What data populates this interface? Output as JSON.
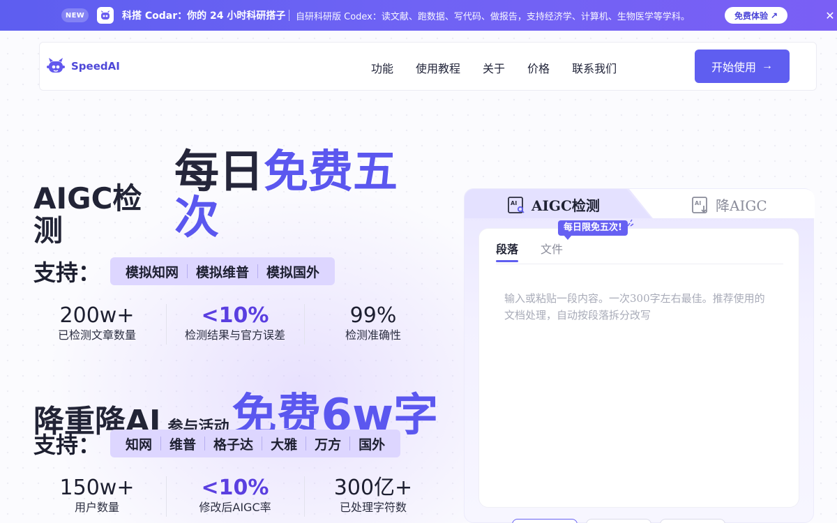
{
  "announcement": {
    "badge": "NEW",
    "title": "科搭 Codar：你的 24 小时科研搭子",
    "description": "自研科研版 Codex：读文献、跑数据、写代码、做报告，支持经济学、计算机、生物医学等学科。",
    "cta_label": "免费体验",
    "close_icon": "close-icon"
  },
  "nav": {
    "brand": "SpeedAI",
    "links": [
      "功能",
      "使用教程",
      "关于",
      "价格",
      "联系我们"
    ],
    "start_label": "开始使用"
  },
  "hero": {
    "aigc_title": "AIGC检测",
    "daily_prefix": "每日",
    "daily_highlight": "免费五次",
    "support_label": "支持：",
    "aigc_platforms": [
      "模拟知网",
      "模拟维普",
      "模拟国外"
    ],
    "aigc_stats": [
      {
        "value": "200w+",
        "label": "已检测文章数量",
        "accent": false
      },
      {
        "value": "<10%",
        "label": "检测结果与官方误差",
        "accent": true
      },
      {
        "value": "99%",
        "label": "检测准确性",
        "accent": false
      }
    ],
    "reduce_title": "降重降AI",
    "reduce_sub": "参与活动",
    "reduce_highlight": "免费6w字",
    "reduce_platforms": [
      "知网",
      "维普",
      "格子达",
      "大雅",
      "万方",
      "国外"
    ],
    "reduce_stats": [
      {
        "value": "150w+",
        "label": "用户数量",
        "accent": false
      },
      {
        "value": "<10%",
        "label": "修改后AIGC率",
        "accent": true
      },
      {
        "value": "300亿+",
        "label": "已处理字符数",
        "accent": false
      }
    ]
  },
  "panel": {
    "tab_aigc": "AIGC检测",
    "tab_reduce": "降AIGC",
    "promo": "每日限免五次!",
    "sub_tabs": [
      "段落",
      "文件"
    ],
    "textarea_placeholder": "输入或粘贴一段内容。一次300字左右最佳。推荐使用的文档处理，自动按段落拆分改写"
  },
  "colors": {
    "brand": "#5f5ef0",
    "highlight": "#5b57ef",
    "accent_stat": "#5a3fe0",
    "chip_bg": "#ddd6ff"
  }
}
